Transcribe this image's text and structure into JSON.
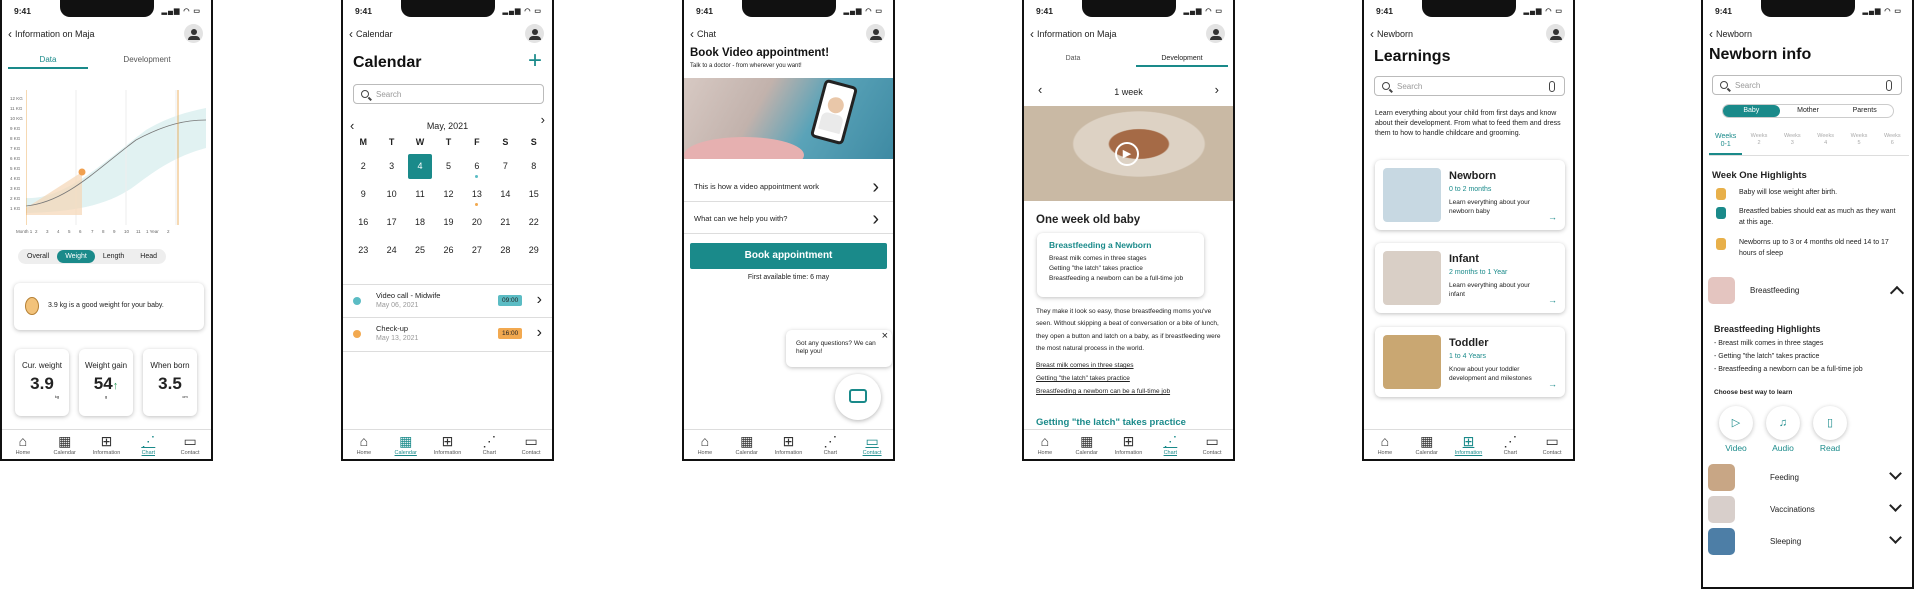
{
  "status_time": "9:41",
  "tabbar": [
    "Home",
    "Calendar",
    "Information",
    "Chart",
    "Contact"
  ],
  "screen1": {
    "back": "Information on Maja",
    "tabs": [
      "Data",
      "Development"
    ],
    "y_ticks": [
      "12 KG",
      "11 KG",
      "10 KG",
      "9 KG",
      "8 KG",
      "7 KG",
      "6 KG",
      "5 KG",
      "4 KG",
      "3 KG",
      "2 KG",
      "1 KG"
    ],
    "x_ticks": [
      "Month 1",
      "2",
      "3",
      "4",
      "5",
      "6",
      "7",
      "8",
      "9",
      "10",
      "11",
      "1 Year",
      "2"
    ],
    "filters": [
      "Overall",
      "Weight",
      "Length",
      "Head"
    ],
    "message": "3.9 kg is a good weight for your baby.",
    "stats": [
      {
        "label": "Cur. weight",
        "value": "3.9",
        "unit": "kg"
      },
      {
        "label": "Weight gain",
        "value": "54",
        "unit": "g"
      },
      {
        "label": "When born",
        "value": "3.5",
        "unit": "cm"
      }
    ]
  },
  "screen2": {
    "back": "Calendar",
    "title": "Calendar",
    "search": "Search",
    "month": "May, 2021",
    "weekdays": [
      "M",
      "T",
      "W",
      "T",
      "F",
      "S",
      "S"
    ],
    "weeks": [
      [
        "2",
        "3",
        "4",
        "5",
        "6",
        "7",
        "8"
      ],
      [
        "9",
        "10",
        "11",
        "12",
        "13",
        "14",
        "15"
      ],
      [
        "16",
        "17",
        "18",
        "19",
        "20",
        "21",
        "22"
      ],
      [
        "23",
        "24",
        "25",
        "26",
        "27",
        "28",
        "29"
      ]
    ],
    "events": [
      {
        "title": "Video call - Midwife",
        "date": "May 06, 2021",
        "time": "09:00",
        "color": "#5bbcc4"
      },
      {
        "title": "Check-up",
        "date": "May 13, 2021",
        "time": "16:00",
        "color": "#f2a950"
      }
    ]
  },
  "screen3": {
    "back": "Chat",
    "title": "Book Video appointment!",
    "subtitle": "Talk to a doctor - from wherever you want!",
    "rows": [
      "This is how a video appointment work",
      "What can we help you with?"
    ],
    "button": "Book appointment",
    "available": "First available time: 6 may",
    "bubble": "Got any questions? We can help you!"
  },
  "screen4": {
    "back": "Information on Maja",
    "tabs": [
      "Data",
      "Development"
    ],
    "week": "1 week",
    "heading": "One week old baby",
    "card_title": "Breastfeeding a Newborn",
    "card_items": [
      "Breast milk comes in three stages",
      "Getting \"the latch\" takes practice",
      "Breastfeeding a newborn can be a full-time job"
    ],
    "body": "They make it look so easy, those breastfeeding moms you've seen. Without skipping a beat of conversation or a bite of lunch, they open a button and latch on a baby, as if breastfeeding were the most natural process in the world.",
    "links": [
      "Breast milk comes in three stages",
      "Getting \"the latch\" takes practice",
      "Breastfeeding a newborn can be a full-time job"
    ],
    "section": "Getting \"the latch\" takes practice"
  },
  "screen5": {
    "back": "Newborn",
    "title": "Learnings",
    "search": "Search",
    "intro": "Learn everything about your child from first days and know about their development. From what to feed them and dress them to how to handle childcare and grooming.",
    "cards": [
      {
        "title": "Newborn",
        "age": "0 to 2 months",
        "desc": "Learn everything about your newborn baby"
      },
      {
        "title": "Infant",
        "age": "2 months to 1 Year",
        "desc": "Learn everything about your infant"
      },
      {
        "title": "Toddler",
        "age": "1 to 4 Years",
        "desc": "Know about your toddler development and milestones"
      }
    ]
  },
  "screen6": {
    "back": "Newborn",
    "title": "Newborn info",
    "search": "Search",
    "segments": [
      "Baby",
      "Mother",
      "Parents"
    ],
    "weeks": [
      [
        "Weeks",
        "0-1"
      ],
      [
        "Weeks",
        "2"
      ],
      [
        "Weeks",
        "3"
      ],
      [
        "Weeks",
        "4"
      ],
      [
        "Weeks",
        "5"
      ],
      [
        "Weeks",
        "6"
      ]
    ],
    "highlights_title": "Week One Highlights",
    "highlights": [
      "Baby will lose weight after birth.",
      "Breastfed babies should eat as much as they want at this age.",
      "Newborns up to 3 or 4 months old need 14 to 17 hours of sleep"
    ],
    "accordion_open": "Breastfeeding",
    "bf_title": "Breastfeeding Highlights",
    "bf_items": [
      "- Breast milk comes in three stages",
      "- Getting \"the latch\" takes practice",
      "- Breastfeeding a newborn can be a full-time job"
    ],
    "choose": "Choose best way to learn",
    "media": [
      "Video",
      "Audio",
      "Read"
    ],
    "accordions": [
      "Feeding",
      "Vaccinations",
      "Sleeping"
    ]
  }
}
